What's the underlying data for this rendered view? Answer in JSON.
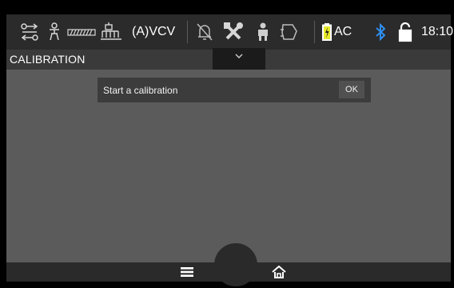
{
  "status_bar": {
    "ventilation_mode": "(A)VCV",
    "power_source": "AC",
    "time": "18:10",
    "icons": [
      "gas-supply-icon",
      "patient-icon",
      "pressure-bar-icon",
      "stand-icon",
      "alarm-silenced-icon",
      "tools-icon",
      "operator-icon",
      "mask-icon",
      "battery-icon",
      "bluetooth-icon",
      "unlocked-icon"
    ],
    "colors": {
      "battery_charge": "#e8ea2a",
      "bluetooth": "#2f8ff0"
    }
  },
  "header": {
    "title": "CALIBRATION",
    "dropdown_icon": "chevron-down-icon"
  },
  "main": {
    "message": "Start a calibration",
    "ok_label": "OK"
  },
  "bottom_nav": {
    "items": [
      "menu-icon",
      "home-icon"
    ]
  }
}
